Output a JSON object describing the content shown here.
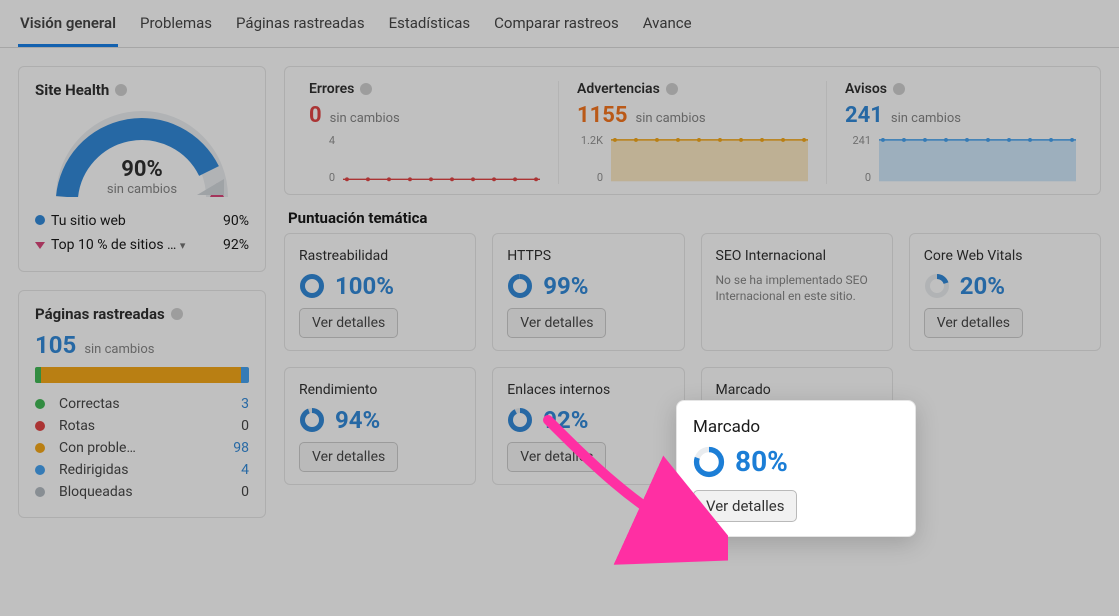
{
  "tabs": [
    {
      "label": "Visión general",
      "active": true
    },
    {
      "label": "Problemas"
    },
    {
      "label": "Páginas rastreadas"
    },
    {
      "label": "Estadísticas"
    },
    {
      "label": "Comparar rastreos"
    },
    {
      "label": "Avance"
    }
  ],
  "site_health": {
    "title": "Site Health",
    "percent": "90%",
    "sub": "sin cambios",
    "legend": [
      {
        "marker": "dot",
        "color": "#1c7ed6",
        "label": "Tu sitio web",
        "value": "90%"
      },
      {
        "marker": "caret",
        "color": "#d6336c",
        "label": "Top 10 % de sitios …",
        "value": "92%",
        "chevron": true
      }
    ]
  },
  "metrics": [
    {
      "title": "Errores",
      "value": "0",
      "cls": "err",
      "sub": "sin cambios",
      "yticks": [
        "4",
        "0"
      ],
      "series_color": "#e03131",
      "fill": "none",
      "flat": true
    },
    {
      "title": "Advertencias",
      "value": "1155",
      "cls": "warn",
      "sub": "sin cambios",
      "yticks": [
        "1.2K",
        "0"
      ],
      "series_color": "#f59f00",
      "fill": "rgba(245,159,0,0.25)",
      "flat": false
    },
    {
      "title": "Avisos",
      "value": "241",
      "cls": "note",
      "sub": "sin cambios",
      "yticks": [
        "241",
        "0"
      ],
      "series_color": "#339af0",
      "fill": "rgba(51,154,240,0.25)",
      "flat": false
    }
  ],
  "thematic": {
    "section_title": "Puntuación temática",
    "cards": [
      {
        "title": "Rastreabilidad",
        "pct": "100%",
        "ring": 100,
        "btn": "Ver detalles"
      },
      {
        "title": "HTTPS",
        "pct": "99%",
        "ring": 99,
        "btn": "Ver detalles"
      },
      {
        "title": "SEO Internacional",
        "note": "No se ha implementado SEO Internacional en este sitio."
      },
      {
        "title": "Core Web Vitals",
        "pct": "20%",
        "ring": 20,
        "btn": "Ver detalles"
      },
      {
        "title": "Rendimiento",
        "pct": "94%",
        "ring": 94,
        "btn": "Ver detalles"
      },
      {
        "title": "Enlaces internos",
        "pct": "92%",
        "ring": 92,
        "btn": "Ver detalles"
      },
      {
        "title": "Marcado",
        "pct": "80%",
        "ring": 80,
        "btn": "Ver detalles",
        "spotlight": true
      },
      {
        "title": "",
        "empty": true
      }
    ]
  },
  "crawled": {
    "title": "Páginas rastreadas",
    "value": "105",
    "sub": "sin cambios",
    "segments": [
      {
        "label": "Correctas",
        "color": "#2fb344",
        "value": "3",
        "num": 3,
        "link": true
      },
      {
        "label": "Rotas",
        "color": "#e03131",
        "value": "0",
        "num": 0
      },
      {
        "label": "Con proble…",
        "color": "#f59f00",
        "value": "98",
        "num": 98,
        "link": true
      },
      {
        "label": "Redirigidas",
        "color": "#339af0",
        "value": "4",
        "num": 4,
        "link": true
      },
      {
        "label": "Bloqueadas",
        "color": "#adb5bd",
        "value": "0",
        "num": 0
      }
    ]
  },
  "chart_data": [
    {
      "type": "line",
      "title": "Errores",
      "x": [
        1,
        2,
        3,
        4,
        5,
        6,
        7,
        8,
        9,
        10
      ],
      "values": [
        0,
        0,
        0,
        0,
        0,
        0,
        0,
        0,
        0,
        0
      ],
      "ylim": [
        0,
        4
      ]
    },
    {
      "type": "area",
      "title": "Advertencias",
      "x": [
        1,
        2,
        3,
        4,
        5,
        6,
        7,
        8,
        9,
        10
      ],
      "values": [
        1155,
        1155,
        1155,
        1155,
        1155,
        1155,
        1155,
        1155,
        1155,
        1155
      ],
      "ylim": [
        0,
        1200
      ]
    },
    {
      "type": "area",
      "title": "Avisos",
      "x": [
        1,
        2,
        3,
        4,
        5,
        6,
        7,
        8,
        9,
        10
      ],
      "values": [
        241,
        241,
        241,
        241,
        241,
        241,
        241,
        241,
        241,
        241
      ],
      "ylim": [
        0,
        241
      ]
    },
    {
      "type": "gauge",
      "title": "Site Health",
      "value": 90,
      "max": 100
    }
  ]
}
